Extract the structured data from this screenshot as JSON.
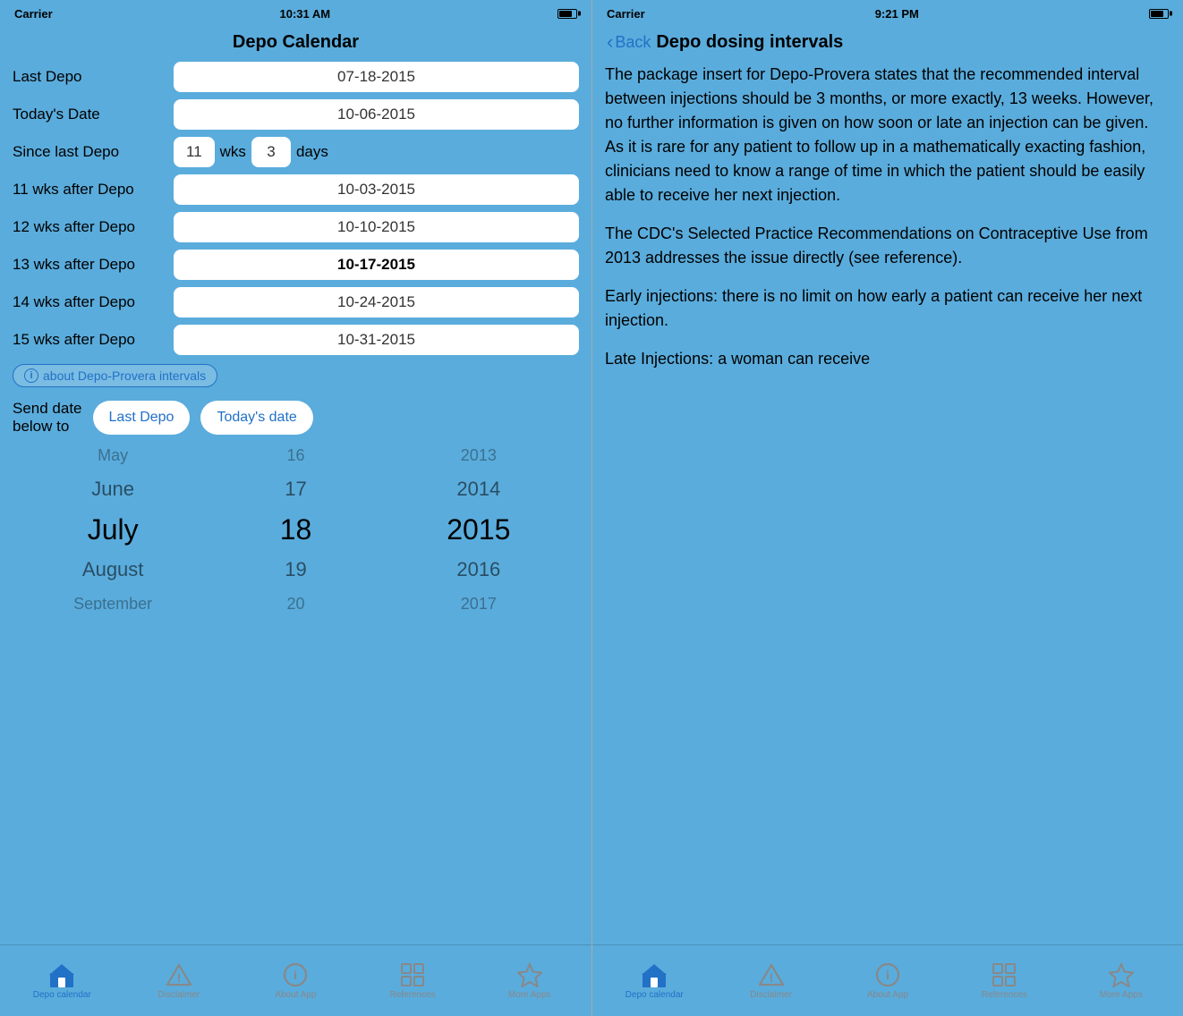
{
  "left_phone": {
    "status": {
      "carrier": "Carrier",
      "wifi": "WiFi",
      "time": "10:31 AM",
      "battery": ""
    },
    "header": "Depo Calendar",
    "fields": [
      {
        "label": "Last Depo",
        "value": "07-18-2015",
        "bold": false
      },
      {
        "label": "Today's Date",
        "value": "10-06-2015",
        "bold": false
      }
    ],
    "since_label": "Since last Depo",
    "since_weeks": "11",
    "since_weeks_unit": "wks",
    "since_days": "3",
    "since_days_unit": "days",
    "week_rows": [
      {
        "label": "11 wks after Depo",
        "value": "10-03-2015",
        "bold": false
      },
      {
        "label": "12 wks after Depo",
        "value": "10-10-2015",
        "bold": false
      },
      {
        "label": "13 wks after Depo",
        "value": "10-17-2015",
        "bold": true
      },
      {
        "label": "14 wks after Depo",
        "value": "10-24-2015",
        "bold": false
      },
      {
        "label": "15 wks after Depo",
        "value": "10-31-2015",
        "bold": false
      }
    ],
    "info_btn": "about Depo-Provera intervals",
    "send_label": "Send date\nbelow to",
    "send_btn1": "Last Depo",
    "send_btn2": "Today's date",
    "picker": {
      "months": [
        "May",
        "June",
        "July",
        "August",
        "September"
      ],
      "days": [
        "16",
        "17",
        "18",
        "19",
        "20"
      ],
      "years": [
        "2013",
        "2014",
        "2015",
        "2016",
        "2017"
      ]
    },
    "tabs": [
      {
        "label": "Depo calendar",
        "icon": "house",
        "active": true
      },
      {
        "label": "Disclaimer",
        "icon": "warning",
        "active": false
      },
      {
        "label": "About App",
        "icon": "info",
        "active": false
      },
      {
        "label": "References",
        "icon": "grid",
        "active": false
      },
      {
        "label": "More Apps",
        "icon": "star",
        "active": false
      }
    ]
  },
  "right_phone": {
    "status": {
      "carrier": "Carrier",
      "wifi": "WiFi",
      "time": "9:21 PM",
      "battery": ""
    },
    "back_label": "Back",
    "page_title": "Depo dosing intervals",
    "content": [
      "The package insert for Depo-Provera states that the recommended interval between injections should be 3 months, or more exactly, 13 weeks. However, no further information is given on how soon or late an injection can be given.  As it is rare for any patient to follow up in a mathematically exacting fashion, clinicians need to know a range of time in which the patient should be easily able to receive her next injection.",
      "The CDC's Selected Practice Recommendations on Contraceptive Use from 2013 addresses the issue directly (see reference).",
      "Early injections:  there is no limit on how early a patient can receive her next injection.",
      "Late Injections:  a woman can receive"
    ],
    "tabs": [
      {
        "label": "Depo calendar",
        "icon": "house",
        "active": true
      },
      {
        "label": "Disclaimer",
        "icon": "warning",
        "active": false
      },
      {
        "label": "About App",
        "icon": "info",
        "active": false
      },
      {
        "label": "References",
        "icon": "grid",
        "active": false
      },
      {
        "label": "More Apps",
        "icon": "star",
        "active": false
      }
    ]
  }
}
